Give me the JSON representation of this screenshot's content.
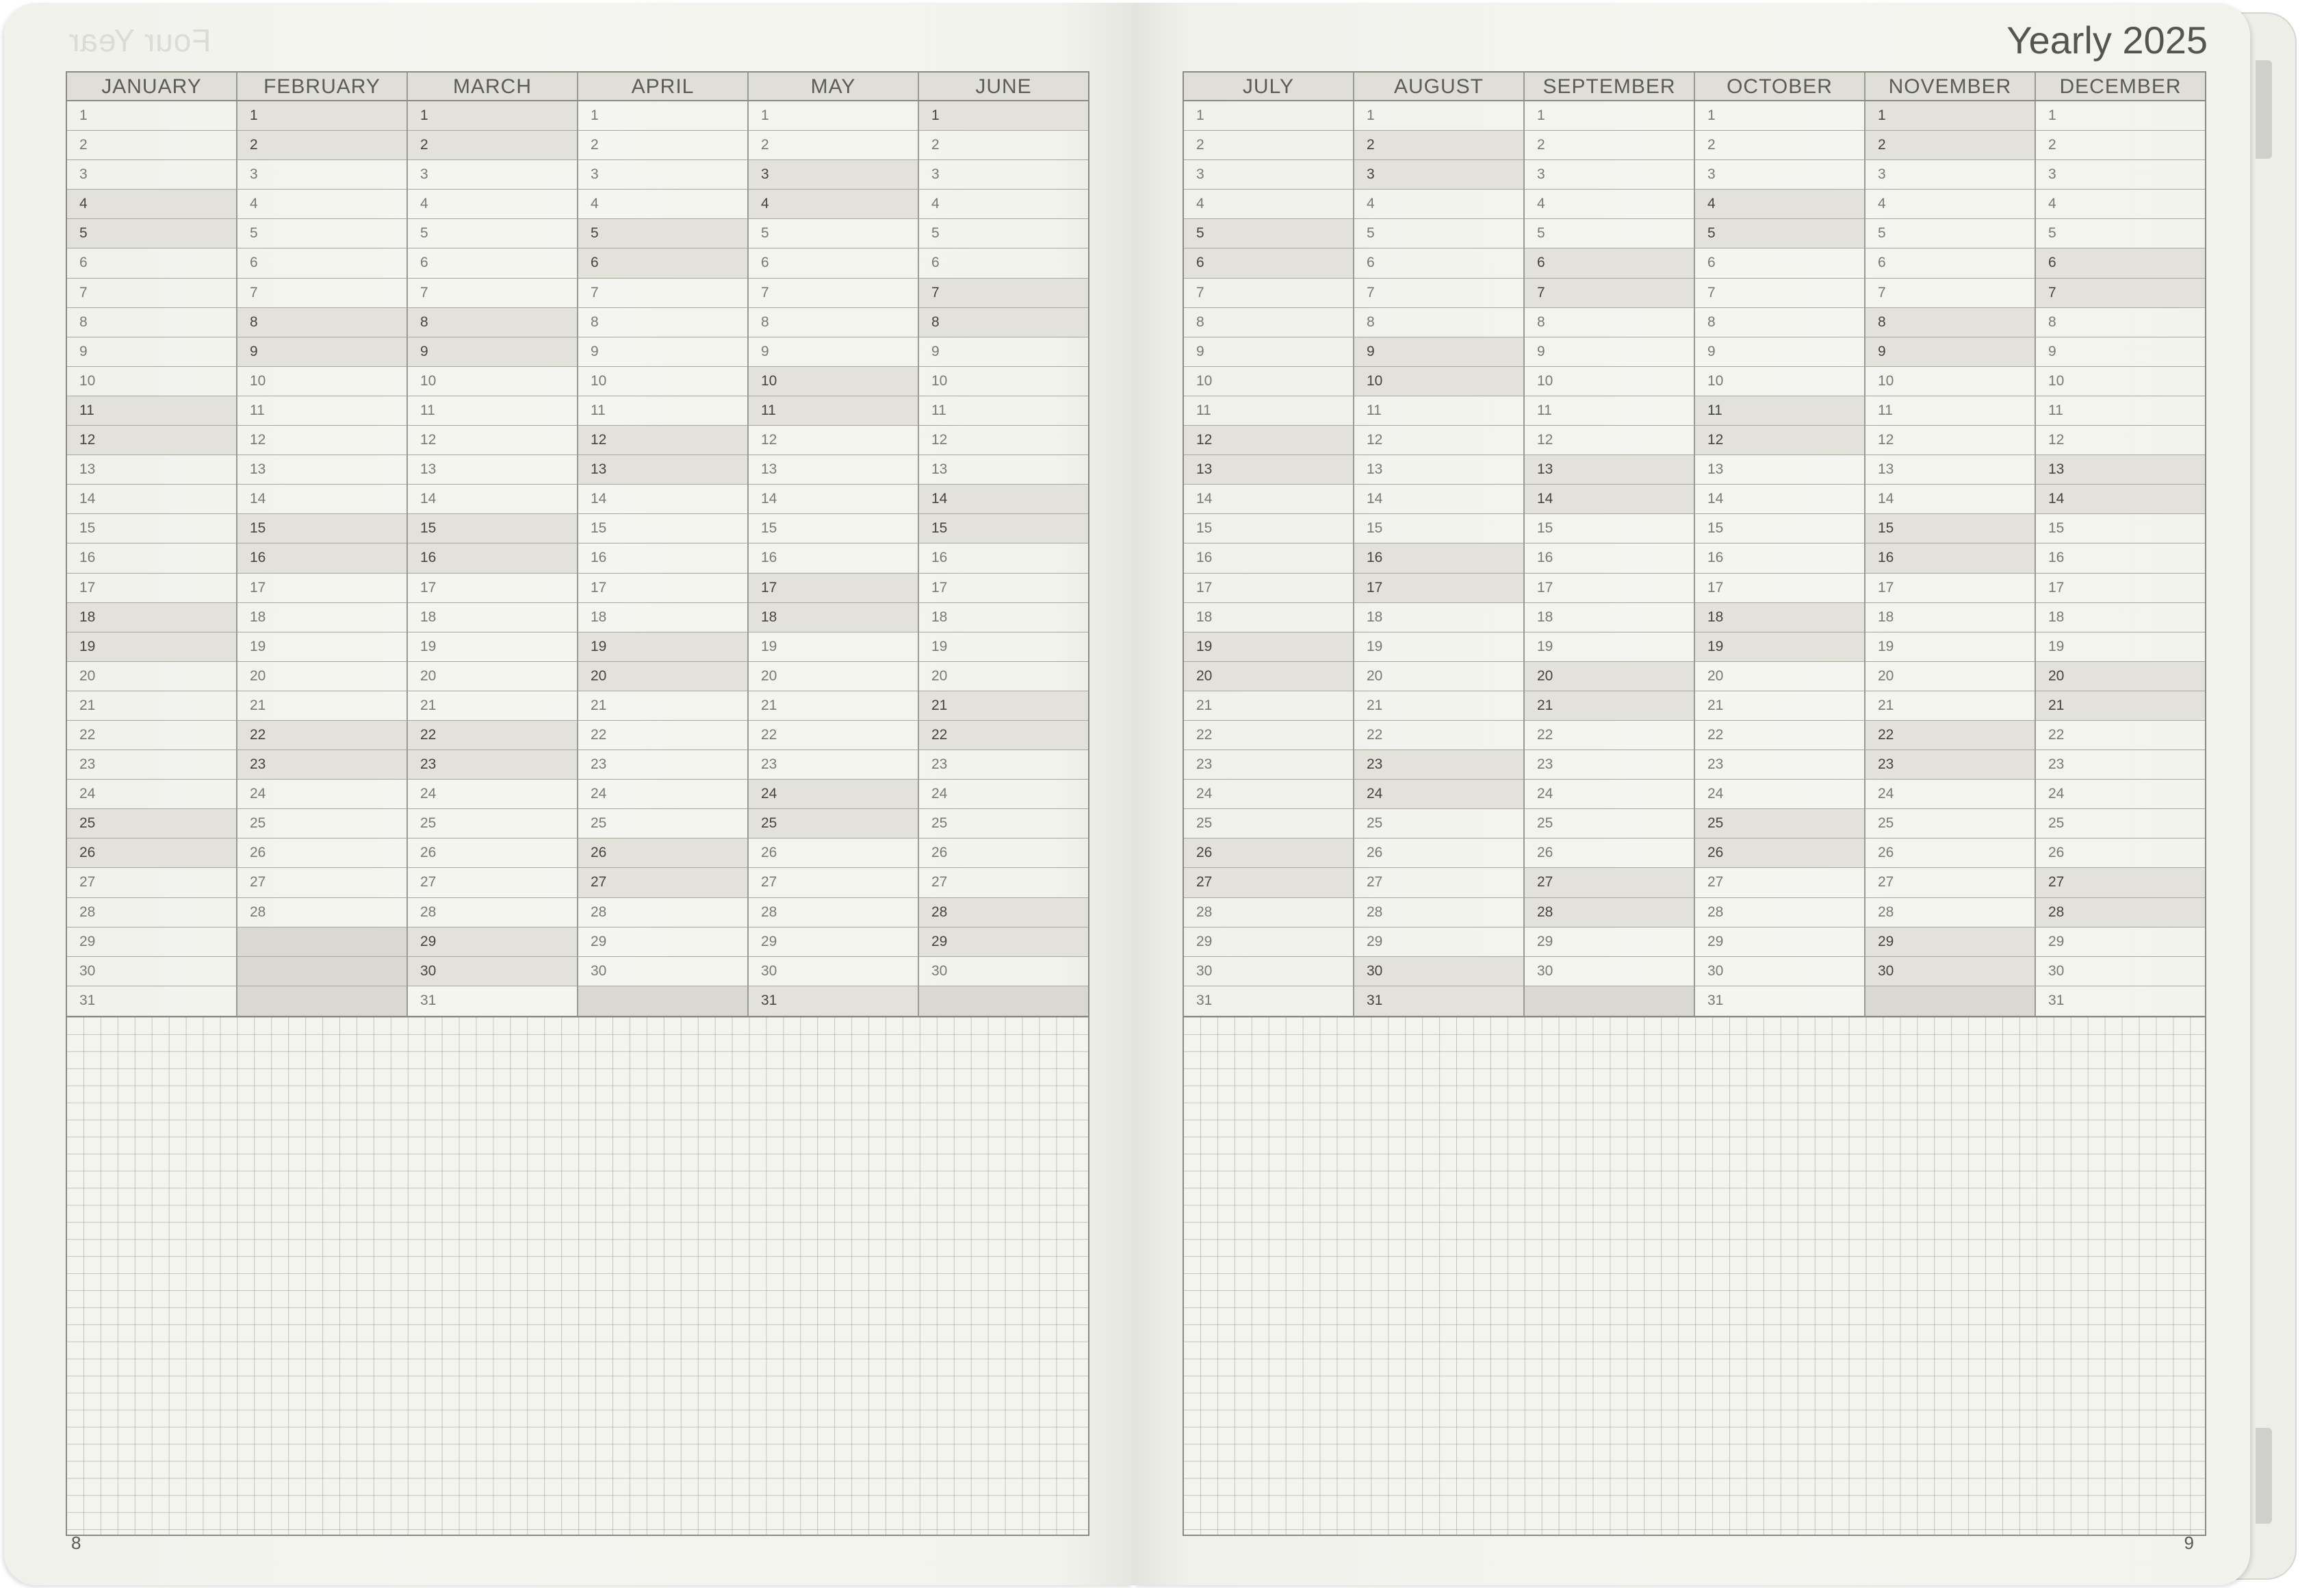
{
  "left_page": {
    "ghost_title": "Four Year",
    "page_number": "8",
    "months": [
      {
        "name": "JANUARY",
        "days": 31,
        "weekends": [
          4,
          5,
          11,
          12,
          18,
          19,
          25,
          26
        ]
      },
      {
        "name": "FEBRUARY",
        "days": 28,
        "weekends": [
          1,
          2,
          8,
          9,
          15,
          16,
          22,
          23
        ]
      },
      {
        "name": "MARCH",
        "days": 31,
        "weekends": [
          1,
          2,
          8,
          9,
          15,
          16,
          22,
          23,
          29,
          30
        ]
      },
      {
        "name": "APRIL",
        "days": 30,
        "weekends": [
          5,
          6,
          12,
          13,
          19,
          20,
          26,
          27
        ]
      },
      {
        "name": "MAY",
        "days": 31,
        "weekends": [
          3,
          4,
          10,
          11,
          17,
          18,
          24,
          25,
          31
        ]
      },
      {
        "name": "JUNE",
        "days": 30,
        "weekends": [
          1,
          7,
          8,
          14,
          15,
          21,
          22,
          28,
          29
        ]
      }
    ]
  },
  "right_page": {
    "title": "Yearly 2025",
    "page_number": "9",
    "months": [
      {
        "name": "JULY",
        "days": 31,
        "weekends": [
          5,
          6,
          12,
          13,
          19,
          20,
          26,
          27
        ]
      },
      {
        "name": "AUGUST",
        "days": 31,
        "weekends": [
          2,
          3,
          9,
          10,
          16,
          17,
          23,
          24,
          30,
          31
        ]
      },
      {
        "name": "SEPTEMBER",
        "days": 30,
        "weekends": [
          6,
          7,
          13,
          14,
          20,
          21,
          27,
          28
        ]
      },
      {
        "name": "OCTOBER",
        "days": 31,
        "weekends": [
          4,
          5,
          11,
          12,
          18,
          19,
          25,
          26
        ]
      },
      {
        "name": "NOVEMBER",
        "days": 30,
        "weekends": [
          1,
          2,
          8,
          9,
          15,
          16,
          22,
          23,
          29,
          30
        ]
      },
      {
        "name": "DECEMBER",
        "days": 31,
        "weekends": [
          6,
          7,
          13,
          14,
          20,
          21,
          27,
          28
        ]
      }
    ]
  },
  "colors": {
    "weekend_shade": "#e2e2da",
    "empty_shade": "#d9d9d1",
    "grid_line": "#a8a8a2",
    "paper": "#f4f4ef"
  }
}
